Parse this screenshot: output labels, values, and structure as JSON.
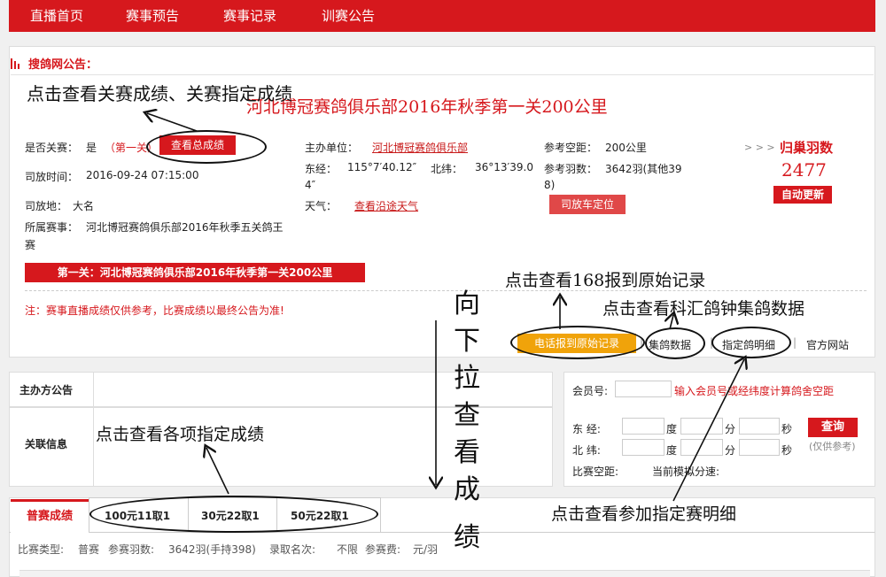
{
  "nav": {
    "items": [
      "直播首页",
      "赛事预告",
      "赛事记录",
      "训赛公告"
    ]
  },
  "notice": {
    "heading": "搜鸽网公告："
  },
  "race": {
    "title": "河北博冠赛鸽俱乐部2016年秋季第一关200公里",
    "is_final_label": "是否关赛：",
    "is_final_value": "是",
    "stage": "（第一关）",
    "total_results_btn": "查看总成绩",
    "release_time_label": "司放时间：",
    "release_time_value": "2016-09-24 07:15:00",
    "release_place_label": "司放地：",
    "release_place_value": "大名",
    "series_label": "所属赛事：",
    "series_value_1": "河北博冠赛鸽俱乐部2016年秋季五关鸽王",
    "series_value_2": "赛",
    "organizer_label": "主办单位：",
    "organizer_value": "河北博冠赛鸽俱乐部",
    "lon_label": "东经：",
    "lon_value": "115°7′40.12″",
    "lat_label": "北纬：",
    "lat_value": "36°13′39.0",
    "coord_tail": "4″",
    "weather_label": "天气：",
    "weather_link": "查看沿途天气",
    "ref_distance_label": "参考空距：",
    "ref_distance_value": "200公里",
    "ref_count_label": "参考羽数：",
    "ref_count_value_1": "3642羽(其他39",
    "ref_count_value_2": "8)",
    "truck_btn": "司放车定位",
    "return_label": "> > >",
    "return_title": "归巢羽数",
    "return_count": "2477",
    "auto_update_btn": "自动更新",
    "stage_bar": "第一关：河北博冠赛鸽俱乐部2016年秋季第一关200公里",
    "disclaimer": "注：赛事直播成绩仅供参考，比赛成绩以最终公告为准!",
    "links": {
      "phone": "电话报到原始记录",
      "collect": "集鸽数据",
      "designated": "指定鸽明细",
      "official": "官方网站",
      "sep": "|"
    }
  },
  "sidebar": {
    "host_notice": "主办方公告",
    "related_info": "关联信息"
  },
  "calculator": {
    "member_label": "会员号:",
    "member_hint": "输入会员号或经纬度计算鸽舍空距",
    "east_label": "东  经:",
    "north_label": "北  纬:",
    "degree": "度",
    "minute": "分",
    "second": "秒",
    "query_btn": "查询",
    "query_note": "(仅供参考)",
    "distance_label": "比赛空距:",
    "speed_label": "当前模拟分速:"
  },
  "tabs": {
    "main": "普赛成绩",
    "items": [
      "100元11取1",
      "30元22取1",
      "50元22取1"
    ]
  },
  "summary": {
    "type_label": "比赛类型:",
    "type_value": "普赛",
    "count_label": "参赛羽数:",
    "count_value": "3642羽(手持398)",
    "quota_label": "录取名次:",
    "quota_value": "不限",
    "fee_label": "参赛费:",
    "fee_value": "元/羽"
  },
  "annotations": {
    "a1": "点击查看关赛成绩、关赛指定成绩",
    "a2": "点击查看168报到原始记录",
    "a3": "点击查看科汇鸽钟集鸽数据",
    "a4": "点击查看各项指定成绩",
    "a5": "点击查看参加指定赛明细",
    "vertical": [
      "向",
      "下",
      "拉",
      "查",
      "看",
      "成",
      "绩"
    ]
  },
  "colors": {
    "brand_red": "#d6181d",
    "orange": "#f0a30a"
  }
}
